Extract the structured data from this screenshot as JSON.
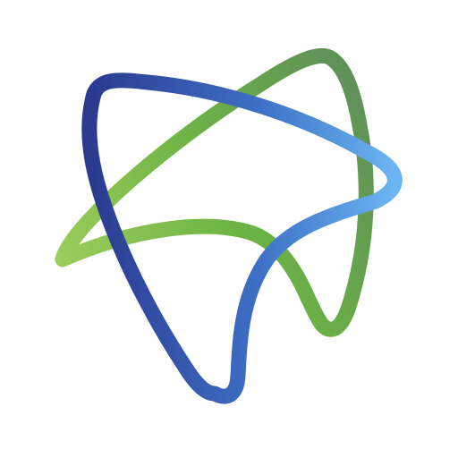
{
  "logo": {
    "icon": "tooth-ribbon-logo",
    "colors": {
      "green_light": "#9ccc5b",
      "green_mid": "#6db445",
      "green_dark": "#5f9158",
      "blue_dark": "#2b3a8f",
      "blue_mid": "#3d6fc5",
      "blue_light": "#6ab5f2"
    }
  }
}
